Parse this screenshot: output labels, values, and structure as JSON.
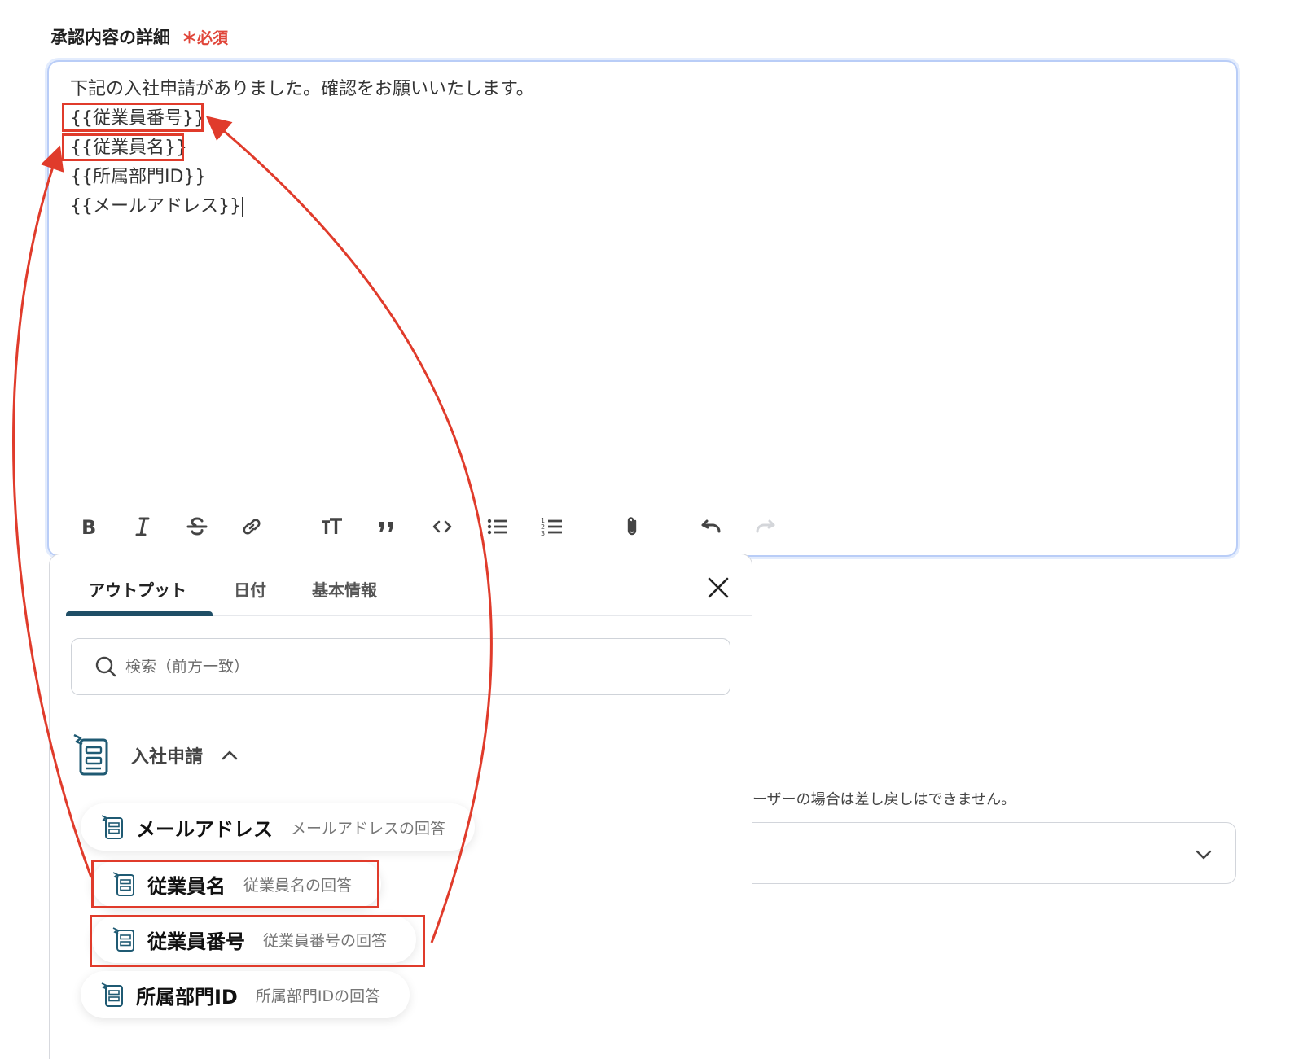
{
  "field": {
    "label": "承認内容の詳細",
    "required": "＊必須"
  },
  "editor": {
    "lines": [
      "下記の入社申請がありました。確認をお願いいたします。",
      "{{従業員番号}}",
      "{{従業員名}}",
      "{{所属部門ID}}",
      "{{メールアドレス}}"
    ]
  },
  "toolbar": {
    "icons": [
      "bold-icon",
      "italic-icon",
      "strikethrough-icon",
      "link-icon",
      "text-size-icon",
      "quote-icon",
      "code-icon",
      "bullet-list-icon",
      "numbered-list-icon",
      "attachment-icon",
      "undo-icon",
      "redo-icon"
    ]
  },
  "panel": {
    "tabs": [
      "アウトプット",
      "日付",
      "基本情報"
    ],
    "search_placeholder": "検索（前方一致）",
    "group_title": "入社申請",
    "items": [
      {
        "name": "メールアドレス",
        "desc": "メールアドレスの回答"
      },
      {
        "name": "従業員名",
        "desc": "従業員名の回答"
      },
      {
        "name": "従業員番号",
        "desc": "従業員番号の回答"
      },
      {
        "name": "所属部門ID",
        "desc": "所属部門IDの回答"
      }
    ]
  },
  "background": {
    "note": "ーザーの場合は差し戻しはできません。"
  },
  "colors": {
    "highlight": "#e03b2b",
    "editor_border": "#b9cdf7",
    "tab_underline": "#1f4e66",
    "required": "#e0463a"
  }
}
